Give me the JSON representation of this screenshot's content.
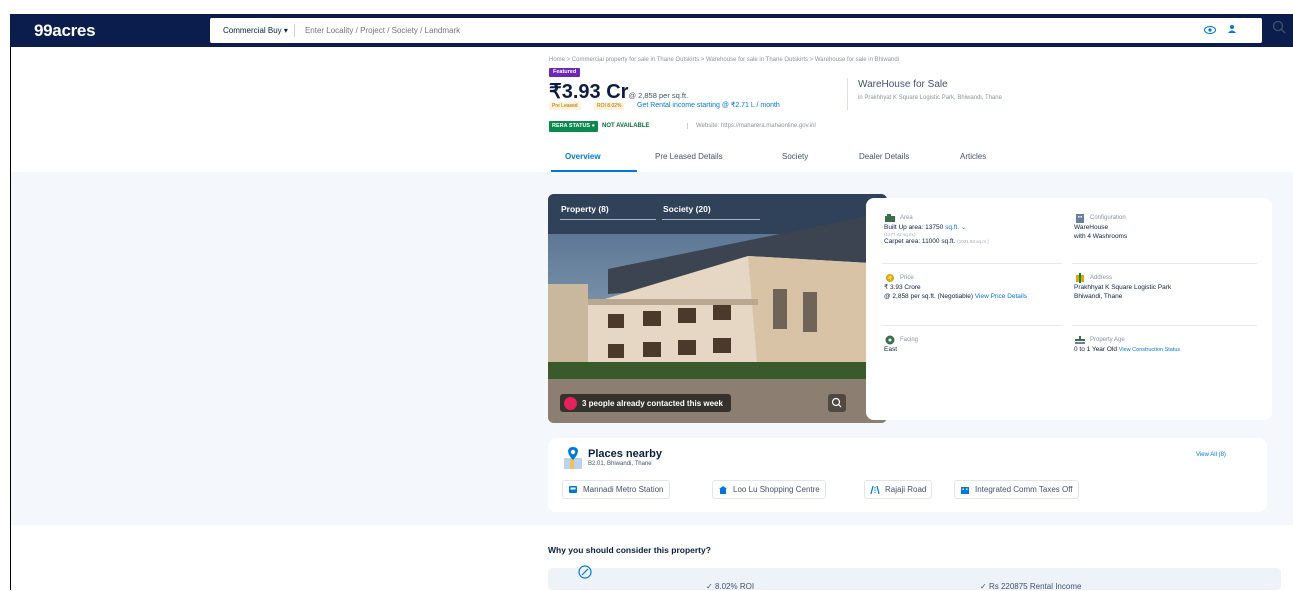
{
  "header": {
    "logo": "99acres",
    "search_type": "Commercial Buy",
    "search_placeholder": "Enter Locality / Project / Society / Landmark"
  },
  "breadcrumb": "Home > Commercial property for sale in Thane Outskirts > Warehouse for sale in Thane Outskirts > Warehouse for sale in Bhiwandi",
  "listing": {
    "badge": "Featured",
    "price": "₹3.93 Cr",
    "price_per_sqft": "@ 2,858 per sq.ft.",
    "chips": [
      "Pre Leased",
      "ROI 8.02%"
    ],
    "rental_income": "Get Rental income starting @ ₹2.71 L / month",
    "title": "WareHouse for Sale",
    "location": "in Prakhhyat K Square Logistic Park, Bhiwandi, Thane",
    "rera_status": "RERA STATUS",
    "rera_value": "NOT AVAILABLE",
    "rera_website": "Website: https://maharera.mahaonline.gov.in/"
  },
  "tabs": [
    "Overview",
    "Pre Leased Details",
    "Society",
    "Dealer Details",
    "Articles"
  ],
  "gallery": {
    "tab_property": "Property (8)",
    "tab_society": "Society (20)",
    "contacted": "3 people already contacted this week"
  },
  "details": {
    "area_label": "Area",
    "area_value": "Built Up area: 13750",
    "area_unit": "sq.ft.",
    "area_sub": "(1277.42 sq.m.)",
    "carpet": "Carpet area: 11000 sq.ft.",
    "carpet_sub": "(1021.93 sq.m.)",
    "config_label": "Configuration",
    "config_value_1": "WareHouse",
    "config_value_2": "with 4 Washrooms",
    "price_label": "Price",
    "price_value": "₹ 3.93 Crore",
    "price_sub": "@ 2,858 per sq.ft. (Negotiable)",
    "price_link": "View Price Details",
    "address_label": "Address",
    "address_1": "Prakhhyat K Square Logistic Park",
    "address_2": "Bhiwandi, Thane",
    "facing_label": "Facing",
    "facing_value": "East",
    "age_label": "Property Age",
    "age_value": "0 to 1 Year Old",
    "age_link": "View Construction Status"
  },
  "nearby": {
    "title": "Places nearby",
    "subtitle": "B2.01, Bhiwandi, Thane",
    "view_all": "View All (8)",
    "places": [
      "Mannadi Metro Station",
      "Loo Lu Shopping Centre",
      "Rajaji Road",
      "Integrated Comm Taxes Off"
    ]
  },
  "why": {
    "title": "Why you should consider this property?",
    "items": [
      "8.02% ROI",
      "Rs 220875 Rental Income"
    ]
  },
  "colors": {
    "brand": "#0a1d4d",
    "link": "#0078db",
    "featured": "#6b28b8",
    "rera": "#0a8a4d"
  }
}
